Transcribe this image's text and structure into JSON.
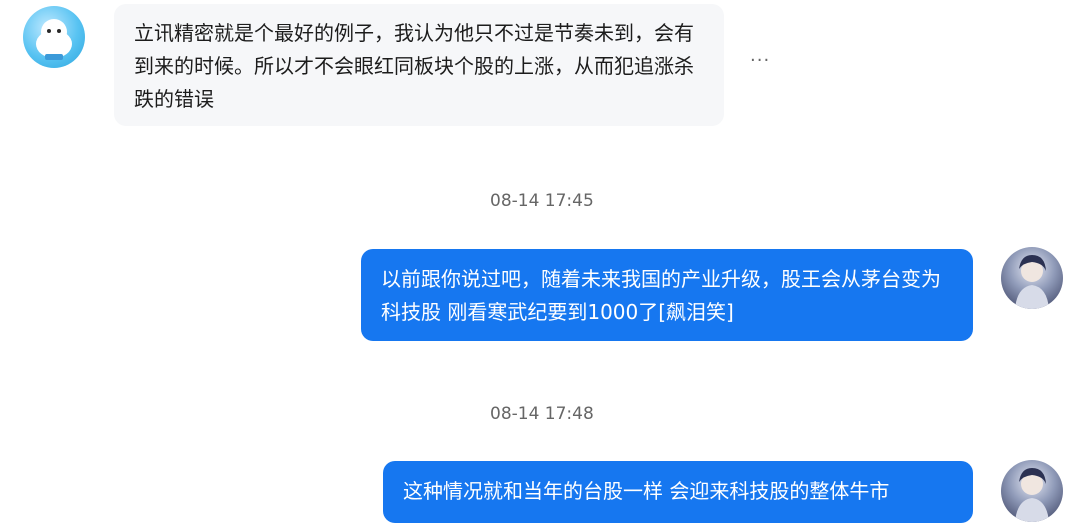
{
  "messages": [
    {
      "direction": "incoming",
      "text": "立讯精密就是个最好的例子，我认为他只不过是节奏未到，会有到来的时候。所以才不会眼红同板块个股的上涨，从而犯追涨杀跌的错误",
      "more_label": "···"
    },
    {
      "timestamp": "08-14 17:45"
    },
    {
      "direction": "outgoing",
      "text": "以前跟你说过吧，随着未来我国的产业升级，股王会从茅台变为科技股 刚看寒武纪要到1000了[飙泪笑]"
    },
    {
      "timestamp": "08-14 17:48"
    },
    {
      "direction": "outgoing",
      "text": "这种情况就和当年的台股一样 会迎来科技股的整体牛市"
    }
  ],
  "colors": {
    "incoming_bubble": "#f6f7f9",
    "outgoing_bubble": "#1677f0",
    "timestamp_text": "#666666"
  },
  "icons": {
    "left_avatar": "cartoon-avatar",
    "right_avatar": "user-photo-avatar",
    "more": "more-dots-icon"
  }
}
